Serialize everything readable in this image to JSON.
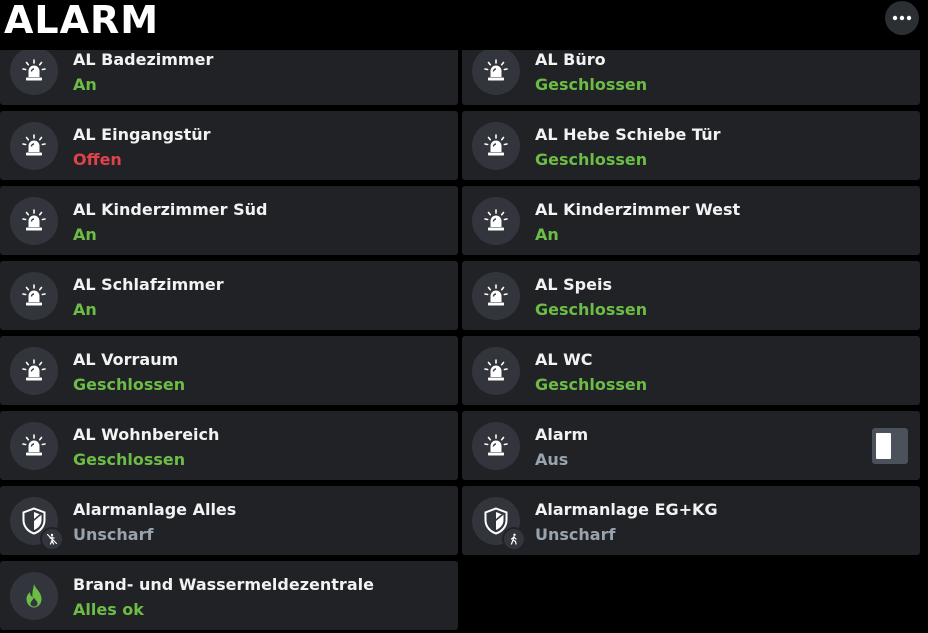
{
  "header": {
    "title": "ALARM",
    "more_icon": "more-horizontal-icon"
  },
  "colors": {
    "background": "#000000",
    "tile": "#202226",
    "ok_green": "#6cbc46",
    "alert_red": "#e0424c",
    "neutral_gray": "#9aa3ad",
    "text": "#f2f2f2"
  },
  "tiles": [
    {
      "name": "AL Badezimmer",
      "state": "An",
      "status": "ok",
      "icon": "siren-icon"
    },
    {
      "name": "AL Büro",
      "state": "Geschlossen",
      "status": "ok",
      "icon": "siren-icon"
    },
    {
      "name": "AL Eingangstür",
      "state": "Offen",
      "status": "alert",
      "icon": "siren-icon"
    },
    {
      "name": "AL Hebe Schiebe Tür",
      "state": "Geschlossen",
      "status": "ok",
      "icon": "siren-icon"
    },
    {
      "name": "AL Kinderzimmer Süd",
      "state": "An",
      "status": "ok",
      "icon": "siren-icon"
    },
    {
      "name": "AL Kinderzimmer West",
      "state": "An",
      "status": "ok",
      "icon": "siren-icon"
    },
    {
      "name": "AL Schlafzimmer",
      "state": "An",
      "status": "ok",
      "icon": "siren-icon"
    },
    {
      "name": "AL Speis",
      "state": "Geschlossen",
      "status": "ok",
      "icon": "siren-icon"
    },
    {
      "name": "AL Vorraum",
      "state": "Geschlossen",
      "status": "ok",
      "icon": "siren-icon"
    },
    {
      "name": "AL WC",
      "state": "Geschlossen",
      "status": "ok",
      "icon": "siren-icon"
    },
    {
      "name": "AL Wohnbereich",
      "state": "Geschlossen",
      "status": "ok",
      "icon": "siren-icon"
    },
    {
      "name": "Alarm",
      "state": "Aus",
      "status": "neutral",
      "icon": "siren-icon",
      "toggle": "off"
    },
    {
      "name": "Alarmanlage Alles",
      "state": "Unscharf",
      "status": "neutral",
      "icon": "shield-icon",
      "badge": "disarmed-person-icon"
    },
    {
      "name": "Alarmanlage EG+KG",
      "state": "Unscharf",
      "status": "neutral",
      "icon": "shield-icon",
      "badge": "walking-person-icon"
    },
    {
      "name": "Brand- und Wassermeldezentrale",
      "state": "Alles ok",
      "status": "ok",
      "icon": "fire-icon"
    }
  ]
}
